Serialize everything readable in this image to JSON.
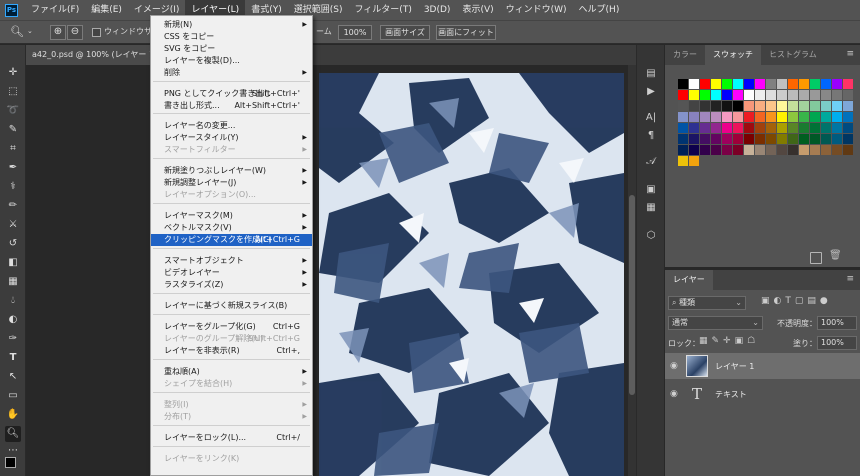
{
  "app_icon": "Ps",
  "menubar": {
    "items": [
      "ファイル(F)",
      "編集(E)",
      "イメージ(I)",
      "レイヤー(L)",
      "書式(Y)",
      "選択範囲(S)",
      "フィルター(T)",
      "3D(D)",
      "表示(V)",
      "ウィンドウ(W)",
      "ヘルプ(H)"
    ],
    "active_index": 3
  },
  "options": {
    "window_fit_label": "ウィンドウサイズ",
    "zoom_clipped": "ーム",
    "zoom_value": "100%",
    "screen_size": "画面サイズ",
    "fit_screen": "画面にフィット"
  },
  "document_tab": "a42_0.psd @ 100% (レイヤー 1, RGB",
  "layer_menu": {
    "items": [
      {
        "label": "新規(N)",
        "shortcut": "",
        "arrow": true,
        "disabled": false,
        "highlight": false
      },
      {
        "label": "CSS をコピー",
        "shortcut": "",
        "arrow": false,
        "disabled": false,
        "highlight": false
      },
      {
        "label": "SVG をコピー",
        "shortcut": "",
        "arrow": false,
        "disabled": false,
        "highlight": false
      },
      {
        "label": "レイヤーを複製(D)...",
        "shortcut": "",
        "arrow": false,
        "disabled": false,
        "highlight": false
      },
      {
        "label": "削除",
        "shortcut": "",
        "arrow": true,
        "disabled": false,
        "highlight": false
      },
      {
        "label": "PNG としてクイック書き出し",
        "shortcut": "Shift+Ctrl+'",
        "arrow": false,
        "disabled": false,
        "highlight": false
      },
      {
        "label": "書き出し形式...",
        "shortcut": "Alt+Shift+Ctrl+'",
        "arrow": false,
        "disabled": false,
        "highlight": false
      },
      {
        "label": "レイヤー名の変更...",
        "shortcut": "",
        "arrow": false,
        "disabled": false,
        "highlight": false
      },
      {
        "label": "レイヤースタイル(Y)",
        "shortcut": "",
        "arrow": true,
        "disabled": false,
        "highlight": false
      },
      {
        "label": "スマートフィルター",
        "shortcut": "",
        "arrow": true,
        "disabled": true,
        "highlight": false
      },
      {
        "label": "新規塗りつぶしレイヤー(W)",
        "shortcut": "",
        "arrow": true,
        "disabled": false,
        "highlight": false
      },
      {
        "label": "新規調整レイヤー(J)",
        "shortcut": "",
        "arrow": true,
        "disabled": false,
        "highlight": false
      },
      {
        "label": "レイヤーオプション(O)...",
        "shortcut": "",
        "arrow": false,
        "disabled": true,
        "highlight": false
      },
      {
        "label": "レイヤーマスク(M)",
        "shortcut": "",
        "arrow": true,
        "disabled": false,
        "highlight": false
      },
      {
        "label": "ベクトルマスク(V)",
        "shortcut": "",
        "arrow": true,
        "disabled": false,
        "highlight": false
      },
      {
        "label": "クリッピングマスクを作成(C)",
        "shortcut": "Alt+Ctrl+G",
        "arrow": false,
        "disabled": false,
        "highlight": true
      },
      {
        "label": "スマートオブジェクト",
        "shortcut": "",
        "arrow": true,
        "disabled": false,
        "highlight": false
      },
      {
        "label": "ビデオレイヤー",
        "shortcut": "",
        "arrow": true,
        "disabled": false,
        "highlight": false
      },
      {
        "label": "ラスタライズ(Z)",
        "shortcut": "",
        "arrow": true,
        "disabled": false,
        "highlight": false
      },
      {
        "label": "レイヤーに基づく新規スライス(B)",
        "shortcut": "",
        "arrow": false,
        "disabled": false,
        "highlight": false
      },
      {
        "label": "レイヤーをグループ化(G)",
        "shortcut": "Ctrl+G",
        "arrow": false,
        "disabled": false,
        "highlight": false
      },
      {
        "label": "レイヤーのグループ解除(U)",
        "shortcut": "Shift+Ctrl+G",
        "arrow": false,
        "disabled": true,
        "highlight": false
      },
      {
        "label": "レイヤーを非表示(R)",
        "shortcut": "Ctrl+,",
        "arrow": false,
        "disabled": false,
        "highlight": false
      },
      {
        "label": "重ね順(A)",
        "shortcut": "",
        "arrow": true,
        "disabled": false,
        "highlight": false
      },
      {
        "label": "シェイプを結合(H)",
        "shortcut": "",
        "arrow": true,
        "disabled": true,
        "highlight": false
      },
      {
        "label": "整列(I)",
        "shortcut": "",
        "arrow": true,
        "disabled": true,
        "highlight": false
      },
      {
        "label": "分布(T)",
        "shortcut": "",
        "arrow": true,
        "disabled": true,
        "highlight": false
      },
      {
        "label": "レイヤーをロック(L)...",
        "shortcut": "Ctrl+/",
        "arrow": false,
        "disabled": false,
        "highlight": false
      },
      {
        "label": "レイヤーをリンク(K)",
        "shortcut": "",
        "arrow": false,
        "disabled": true,
        "highlight": false
      }
    ]
  },
  "swatch_panel": {
    "tabs": [
      "カラー",
      "スウォッチ",
      "ヒストグラム"
    ],
    "active_tab": 1,
    "colors": [
      [
        "#000000",
        "#ffffff",
        "#ff0000",
        "#ffff00",
        "#00ff00",
        "#00ffff",
        "#0000ff",
        "#ff00ff",
        "#808080",
        "#c0c0c0",
        "#ff6600",
        "#ff9900",
        "#00cc66",
        "#0066ff",
        "#9900ff",
        "#ff3366"
      ],
      [
        "#ff0000",
        "#ffff00",
        "#00ff00",
        "#00ffff",
        "#0000ff",
        "#ff00ff",
        "#ffffff",
        "#eeeeee",
        "#dddddd",
        "#cccccc",
        "#bbbbbb",
        "#aaaaaa",
        "#999999",
        "#888888",
        "#777777",
        "#666666"
      ],
      [
        "#555555",
        "#444444",
        "#333333",
        "#222222",
        "#111111",
        "#000000",
        "#f7977a",
        "#f9ad81",
        "#fdc68a",
        "#fff79a",
        "#c4df9b",
        "#a2d39c",
        "#82ca9d",
        "#7bcdc8",
        "#6ecff6",
        "#7ea7d8"
      ],
      [
        "#8493ca",
        "#8882be",
        "#a187be",
        "#bc8dbf",
        "#f49ac2",
        "#f6989d",
        "#ed1c24",
        "#f26522",
        "#f7941d",
        "#fff200",
        "#8dc73f",
        "#39b54a",
        "#00a651",
        "#00a99d",
        "#00aeef",
        "#0072bc"
      ],
      [
        "#0054a6",
        "#2e3192",
        "#662d91",
        "#92278f",
        "#ec008c",
        "#ed145b",
        "#9e0b0f",
        "#a0410d",
        "#a3620a",
        "#aba000",
        "#598527",
        "#1a7b30",
        "#007236",
        "#00746b",
        "#0076a3",
        "#004b80"
      ],
      [
        "#003471",
        "#1b1464",
        "#440e62",
        "#630460",
        "#9e005d",
        "#9e0039",
        "#790000",
        "#7b2e00",
        "#7d4900",
        "#827b00",
        "#406618",
        "#005e20",
        "#005826",
        "#005952",
        "#005b7f",
        "#003663"
      ],
      [
        "#002157",
        "#0d004c",
        "#32004b",
        "#4b0049",
        "#7b0046",
        "#7a0026",
        "#c7b299",
        "#998675",
        "#736357",
        "#534741",
        "#37302d",
        "#c69c6d",
        "#a67c52",
        "#8c6239",
        "#754c24",
        "#603913"
      ],
      [
        "#eec20a",
        "#f1a30e"
      ]
    ]
  },
  "layers_panel": {
    "tab": "レイヤー",
    "kind_filter": "種類",
    "blend_mode": "通常",
    "opacity_label": "不透明度：",
    "opacity_value": "100%",
    "lock_label": "ロック：",
    "fill_label": "塗り：",
    "fill_value": "100%",
    "layers": [
      {
        "name": "レイヤー 1",
        "type": "raster",
        "selected": true,
        "visible": true
      },
      {
        "name": "テキスト",
        "type": "text",
        "selected": false,
        "visible": true
      }
    ]
  },
  "icons": {
    "search": "🔍",
    "zoom_in": "⊕",
    "zoom_out": "⊖",
    "eye": "👁",
    "lock": "🔒"
  }
}
